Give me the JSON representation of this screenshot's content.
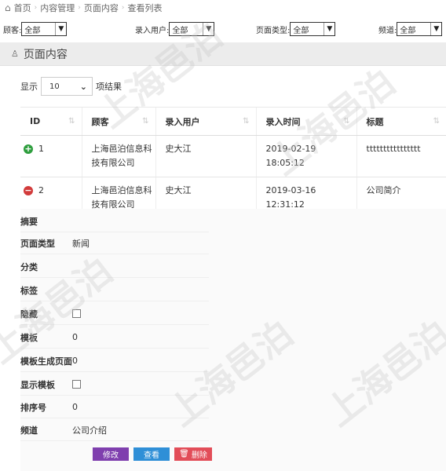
{
  "breadcrumb": {
    "items": [
      "首页",
      "内容管理",
      "页面内容",
      "查看列表"
    ],
    "separator": "›"
  },
  "filters": [
    {
      "label": "顾客:",
      "value": "全部"
    },
    {
      "label": "录入用户:",
      "value": "全部"
    },
    {
      "label": "页面类型:",
      "value": "全部"
    },
    {
      "label": "频道:",
      "value": "全部"
    }
  ],
  "panel": {
    "title": "页面内容"
  },
  "length_menu": {
    "prefix": "显示",
    "value": "10",
    "suffix": "项结果"
  },
  "table": {
    "columns": [
      "ID",
      "顾客",
      "录入用户",
      "录入时间",
      "标题"
    ],
    "rows": [
      {
        "id": "1",
        "customer": "上海邑泊信息科技有限公司",
        "user": "史大江",
        "time": "2019-02-19 18:05:12",
        "title": "tttttttttttttttt",
        "expanded": false
      },
      {
        "id": "2",
        "customer": "上海邑泊信息科技有限公司",
        "user": "史大江",
        "time": "2019-03-16 12:31:12",
        "title": "公司简介",
        "expanded": true
      }
    ]
  },
  "detail": {
    "fields": [
      {
        "key": "摘要",
        "value": ""
      },
      {
        "key": "页面类型",
        "value": "新闻"
      },
      {
        "key": "分类",
        "value": ""
      },
      {
        "key": "标签",
        "value": ""
      },
      {
        "key": "隐藏",
        "value": "",
        "checkbox": true
      },
      {
        "key": "模板",
        "value": "0"
      },
      {
        "key": "模板生成页面",
        "value": "0"
      },
      {
        "key": "显示模板",
        "value": "",
        "checkbox": true
      },
      {
        "key": "排序号",
        "value": "0"
      },
      {
        "key": "频道",
        "value": "公司介绍"
      }
    ],
    "buttons": {
      "edit": "修改",
      "view": "查看",
      "delete": "删除"
    }
  },
  "watermark": "上海邑泊",
  "colors": {
    "edit": "#7f3fae",
    "view": "#2f8fd7",
    "delete": "#e24d58",
    "expand": "#2e9e3e",
    "collapse": "#d23b3b"
  }
}
